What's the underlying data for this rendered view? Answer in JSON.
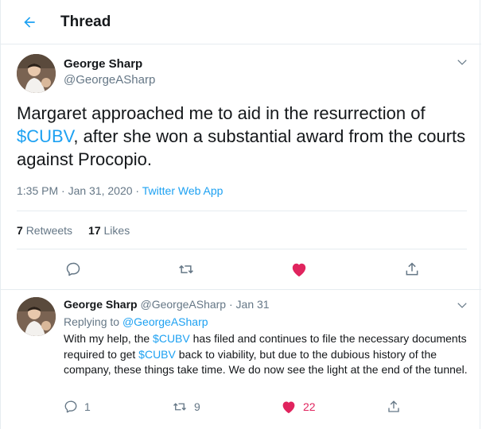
{
  "header": {
    "title": "Thread"
  },
  "main_tweet": {
    "name": "George Sharp",
    "handle": "@GeorgeASharp",
    "text_parts": [
      "Margaret approached me to aid in the resurrection of ",
      "$CUBV",
      ", after she won a substantial award from the courts against Procopio."
    ],
    "timestamp": "1:35 PM · Jan 31, 2020",
    "meta_sep": " · ",
    "source": "Twitter Web App",
    "retweets_count": "7",
    "retweets_label": "Retweets",
    "likes_count": "17",
    "likes_label": "Likes"
  },
  "reply_tweet": {
    "name": "George Sharp",
    "handle": "@GeorgeASharp",
    "date": "Jan 31",
    "date_sep": " · ",
    "replying_label": "Replying to ",
    "replying_handle": "@GeorgeASharp",
    "text_parts": [
      "With my help, the ",
      "$CUBV",
      " has filed and continues to file the necessary documents required to get ",
      "$CUBV",
      " back to viability, but due to the dubious history of the company, these things take time.  We do now see the light at the end of the tunnel."
    ],
    "reply_count": "1",
    "retweet_count": "9",
    "like_count": "22"
  },
  "colors": {
    "accent": "#1da1f2",
    "like": "#e0245e",
    "secondary_text": "#657786",
    "border": "#e6ecf0"
  },
  "icons": [
    "back-arrow-icon",
    "chevron-down-icon",
    "reply-icon",
    "retweet-icon",
    "heart-icon",
    "share-icon"
  ]
}
